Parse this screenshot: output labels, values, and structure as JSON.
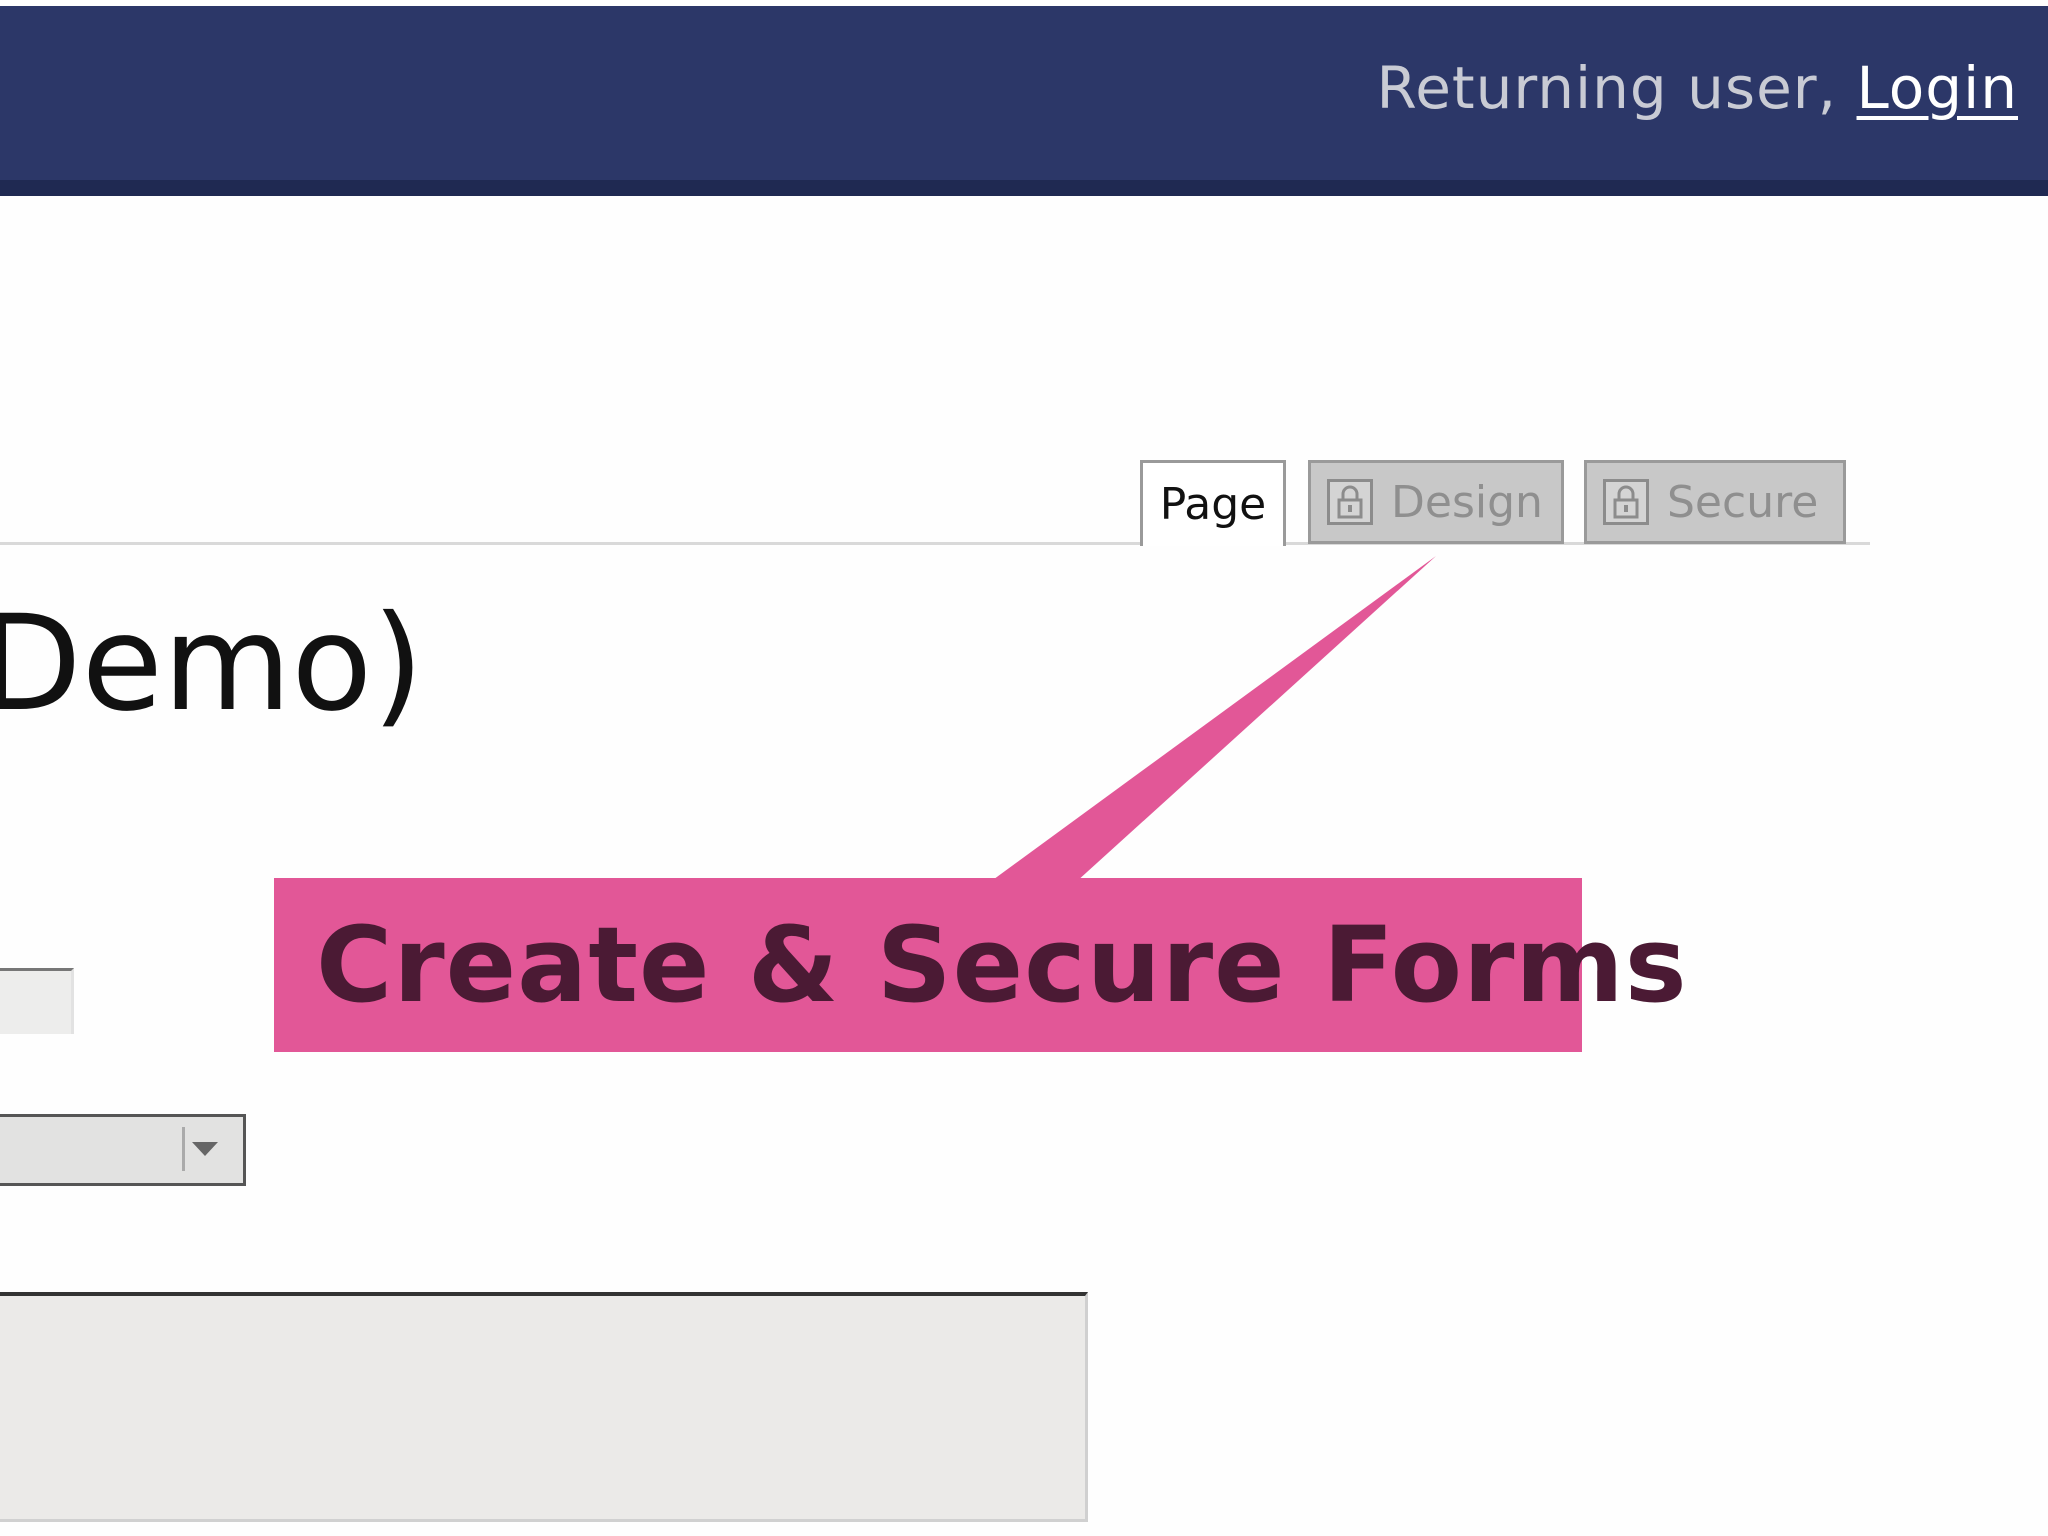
{
  "header": {
    "returning_user_text": "Returning user,",
    "login_link": "Login"
  },
  "tabs": [
    {
      "label": "Page",
      "locked": false,
      "active": true
    },
    {
      "label": "Design",
      "locked": true,
      "active": false
    },
    {
      "label": "Secure",
      "locked": true,
      "active": false
    }
  ],
  "main": {
    "heading_fragment": "Demo)"
  },
  "callout": {
    "text": "Create & Secure Forms"
  },
  "colors": {
    "header_bg": "#2c3768",
    "callout_bg": "#e25797",
    "callout_text": "#4b1a34"
  },
  "icons": {
    "lock": "lock-icon",
    "dropdown": "chevron-down-icon"
  }
}
